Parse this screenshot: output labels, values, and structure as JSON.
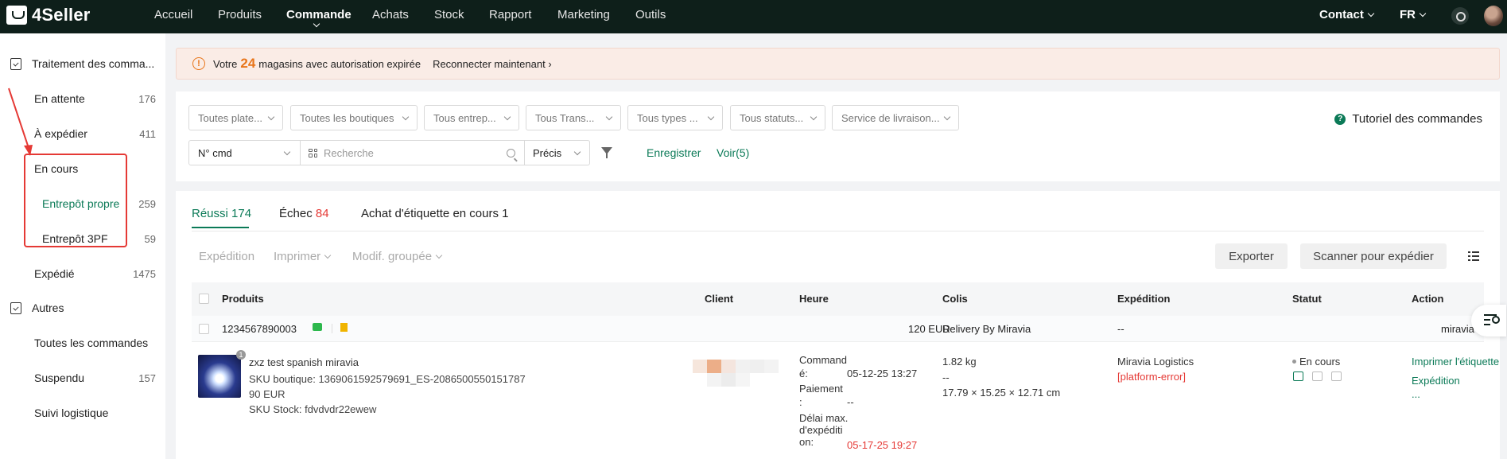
{
  "app": {
    "logo_text": "4Seller"
  },
  "topnav": {
    "items": [
      "Accueil",
      "Produits",
      "Commande",
      "Achats",
      "Stock",
      "Rapport",
      "Marketing",
      "Outils"
    ],
    "active": "Commande",
    "contact_label": "Contact",
    "lang_label": "FR"
  },
  "sidebar": {
    "group1_label": "Traitement des comma...",
    "items": [
      {
        "label": "En attente",
        "count": "176"
      },
      {
        "label": "À expédier",
        "count": "411"
      },
      {
        "label": "En cours",
        "count": ""
      },
      {
        "label": "Entrepôt propre",
        "count": "259"
      },
      {
        "label": "Entrepôt 3PF",
        "count": "59"
      },
      {
        "label": "Expédié",
        "count": "1475"
      }
    ],
    "group2_label": "Autres",
    "items2": [
      {
        "label": "Toutes les commandes",
        "count": ""
      },
      {
        "label": "Suspendu",
        "count": "157"
      },
      {
        "label": "Suivi logistique",
        "count": ""
      }
    ]
  },
  "alert": {
    "prefix": "Votre",
    "count": "24",
    "suffix": "magasins avec autorisation expirée",
    "link": "Reconnecter maintenant"
  },
  "filters": {
    "selects": [
      "Toutes plate...",
      "Toutes les boutiques",
      "Tous entrep...",
      "Tous Trans...",
      "Tous types ...",
      "Tous statuts...",
      "Service de livraison..."
    ],
    "tutorial": "Tutoriel des commandes",
    "search_type": "N° cmd",
    "search_placeholder": "Recherche",
    "match_mode": "Précis",
    "save_label": "Enregistrer",
    "view_label": "Voir(5)"
  },
  "tabs": {
    "success_label": "Réussi",
    "success_count": "174",
    "fail_label": "Échec",
    "fail_count": "84",
    "label_buy": "Achat d'étiquette en cours 1"
  },
  "actions": {
    "shipping": "Expédition",
    "print": "Imprimer",
    "bulk": "Modif. groupée",
    "export": "Exporter",
    "scan": "Scanner pour expédier"
  },
  "table": {
    "headers": [
      "Produits",
      "Client",
      "Heure",
      "Colis",
      "Expédition",
      "Statut",
      "Action"
    ]
  },
  "order": {
    "number": "1234567890003",
    "amount": "120 EUR",
    "delivery": "Delivery By Miravia",
    "shipping_dash": "--",
    "store": "miravia",
    "qty_badge": "1",
    "product_name": "zxz test spanish miravia",
    "sku_shop": "SKU boutique: 1369061592579691_ES-2086500550151787",
    "price": "90 EUR",
    "sku_stock": "SKU Stock: fdvdvdr22ewew",
    "ordered_label": "Command é:",
    "ordered_label_l1": "Command",
    "ordered_label_l2": "é:",
    "ordered_time": "05-12-25 13:27",
    "paid_label_l1": "Paiement",
    "paid_label_l2": ":",
    "paid_time": "--",
    "deadline_l1": "Délai max.",
    "deadline_l2": "d'expéditi",
    "deadline_l3": "on:",
    "deadline_time": "05-17-25 19:27",
    "weight": "1.82 kg",
    "weight_dash": "--",
    "dims": "17.79 × 15.25 × 12.71 cm",
    "carrier": "Miravia Logistics",
    "carrier_error": "[platform-error]",
    "status": "En cours",
    "action_print_label": "Imprimer l'étiquette",
    "action_ship": "Expédition",
    "action_more": "..."
  },
  "colors": {
    "accent": "#0b7a57",
    "nav_bg": "#0e1f1a",
    "alert_orange": "#e8751a",
    "error_red": "#e53935"
  }
}
